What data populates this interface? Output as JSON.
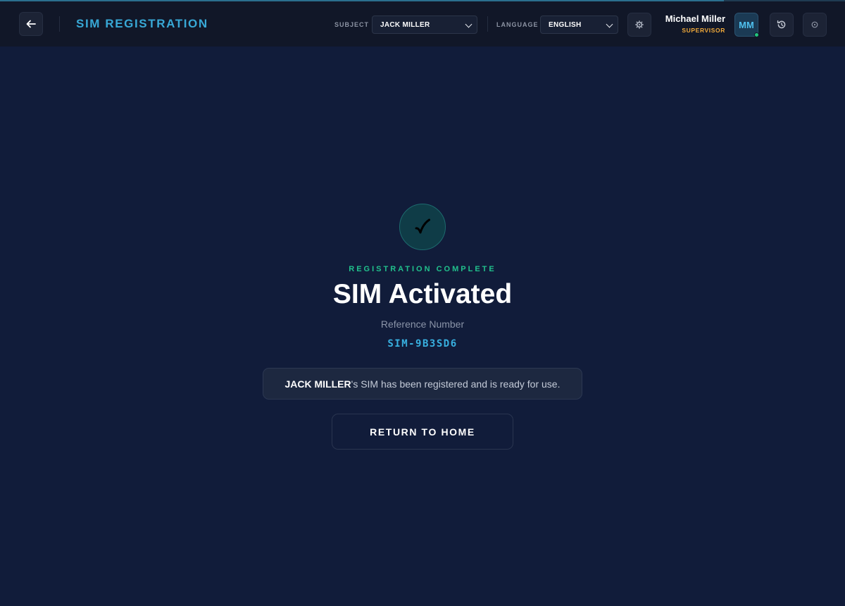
{
  "header": {
    "back_icon": "arrow-left-icon",
    "title": "SIM REGISTRATION",
    "subject_label": "SUBJECT",
    "subject_value": "JACK MILLER",
    "language_label": "LANGUAGE",
    "language_value": "ENGLISH",
    "settings_icon": "gear-icon",
    "user_name": "Michael Miller",
    "user_role": "SUPERVISOR",
    "avatar_initials": "MM",
    "history_icon": "history-icon",
    "power_icon": "power-icon"
  },
  "result": {
    "icon": "checkmark-icon",
    "eyebrow": "REGISTRATION COMPLETE",
    "headline": "SIM Activated",
    "reference_label": "Reference Number",
    "reference_number": "SIM-9B3SD6",
    "message_name": "JACK MILLER",
    "message_text": "'s SIM has been registered and is ready for use.",
    "return_button": "RETURN TO HOME"
  },
  "colors": {
    "background": "#111c3a",
    "topbar": "#111728",
    "accent": "#38a8d6",
    "success": "#21c08c",
    "role": "#f0a93a"
  }
}
